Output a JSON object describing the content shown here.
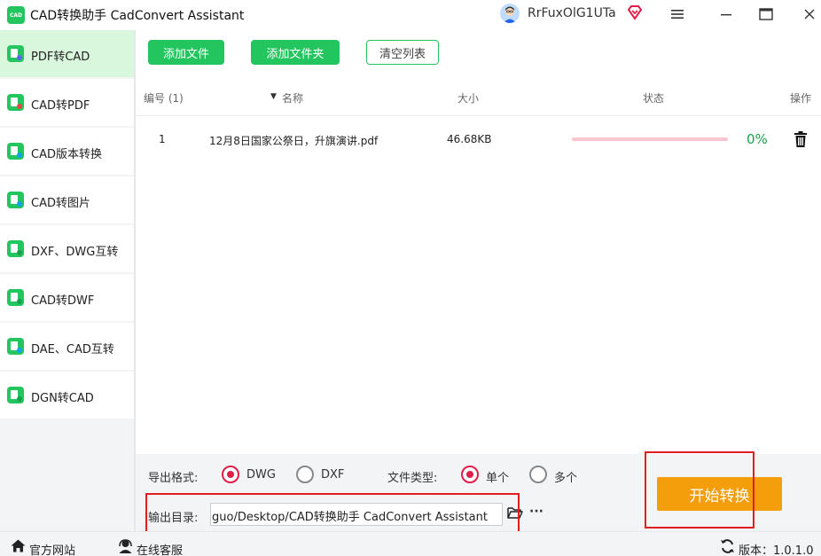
{
  "window": {
    "logo_text": "CAD",
    "title": "CAD转换助手 CadConvert Assistant",
    "username": "RrFuxOlG1UTa",
    "menu_icon": "hamburger-icon",
    "maximize_icon": "maximize-icon",
    "close_icon": "close-icon"
  },
  "sidebar": {
    "items": [
      {
        "label": "PDF转CAD",
        "active": true
      },
      {
        "label": "CAD转PDF",
        "active": false
      },
      {
        "label": "CAD版本转换",
        "active": false
      },
      {
        "label": "CAD转图片",
        "active": false
      },
      {
        "label": "DXF、DWG互转",
        "active": false
      },
      {
        "label": "CAD转DWF",
        "active": false
      },
      {
        "label": "DAE、CAD互转",
        "active": false
      },
      {
        "label": "DGN转CAD",
        "active": false
      }
    ]
  },
  "toolbar": {
    "add_file": "添加文件",
    "add_folder": "添加文件夹",
    "clear_list": "清空列表"
  },
  "table": {
    "headers": {
      "number": "编号 (1)",
      "name": "名称",
      "size": "大小",
      "status": "状态",
      "action": "操作"
    },
    "rows": [
      {
        "number": "1",
        "name": "12月8日国家公祭日，升旗演讲.pdf",
        "size": "46.68KB",
        "progress": 0,
        "progress_text": "0%"
      }
    ]
  },
  "settings": {
    "export_format_label": "导出格式:",
    "format_options": [
      "DWG",
      "DXF"
    ],
    "format_selected": "DWG",
    "file_type_label": "文件类型:",
    "file_type_options": [
      "单个",
      "多个"
    ],
    "file_type_selected": "单个",
    "output_dir_label": "输出目录:",
    "output_dir_value": "guo/Desktop/CAD转换助手 CadConvert Assistant",
    "more_label": "···"
  },
  "start_button": "开始转换",
  "statusbar": {
    "website": "官方网站",
    "support": "在线客服",
    "version": "版本：1.0.1.0"
  },
  "colors": {
    "accent_green": "#22c55e",
    "start_orange": "#f59e0b",
    "radio_red": "#e11d48",
    "highlight_red": "#e11d1d"
  }
}
